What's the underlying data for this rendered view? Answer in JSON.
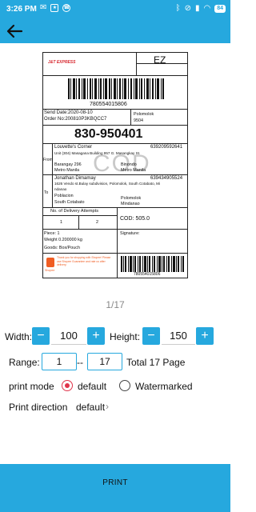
{
  "status_bar": {
    "time": "3:26 PM",
    "battery": "84"
  },
  "label": {
    "courier_logo_text": "J&T EXPRESS",
    "sort_code": "EZ",
    "waybill_number": "780554015806",
    "send_date": "Send Date:2020-08-10",
    "order_no": "Order No:200810P3KBQCC7",
    "origin_city": "Polomolok",
    "origin_code": "9504",
    "route_code": "830-950401",
    "from_label": "From",
    "sender_name": "Louvette's Corner",
    "sender_phone": "639209592641",
    "sender_address": "Unit (304) Masagana Building 957 G. Masangkay St.",
    "sender_barangay": "Barangay 296",
    "sender_area": "Binondo",
    "sender_region": "Metro Manila",
    "sender_region2": "Metro Manila",
    "to_label": "To",
    "recipient_name": "Jonathan Dimamay",
    "recipient_phone": "639434905524",
    "recipient_address": "1626 Vendo st.Bulay subdivision, Polomolok, South Cotabato, Mi",
    "recipient_address2": "ndanao",
    "recipient_barangay": "Poblacion",
    "recipient_city": "Polomolok",
    "recipient_province": "South Cotabato",
    "recipient_region": "Mindanao",
    "cod_watermark": "COD",
    "delivery_attempts_label": "No. of Delivery Attempts",
    "attempt_1": "1",
    "attempt_2": "2",
    "cod_amount": "COD: 505.0",
    "piece": "Piece: 1",
    "weight": "Weight   0.200000 kg",
    "goods": "Goods: Box/Pouch",
    "signature_label": "Signature:",
    "shopee_text": "Thank you for shopping with Shopee! Please use Shopee Guarantee and rate us after delivery.",
    "shopee_brand": "Shopee",
    "bottom_barcode_number": "780554015806"
  },
  "pager": {
    "text": "1/17"
  },
  "width": {
    "label": "Width:",
    "value": "100",
    "minus": "−",
    "plus": "+"
  },
  "height": {
    "label": "Height:",
    "value": "150",
    "minus": "−",
    "plus": "+"
  },
  "range": {
    "label": "Range:",
    "from": "1",
    "separator": "--",
    "to": "17",
    "total": "Total 17 Page"
  },
  "print_mode": {
    "label": "print mode",
    "option_default": "default",
    "option_watermarked": "Watermarked",
    "selected": "default"
  },
  "print_direction": {
    "label": "Print direction",
    "value": "default",
    "chevron": "›"
  },
  "print_button": {
    "label": "PRINT"
  },
  "colors": {
    "primary": "#26a8de",
    "radio_selected": "#e0334a",
    "jt_red": "#d7262d"
  },
  "icons": {
    "back": "arrow-left-icon"
  }
}
